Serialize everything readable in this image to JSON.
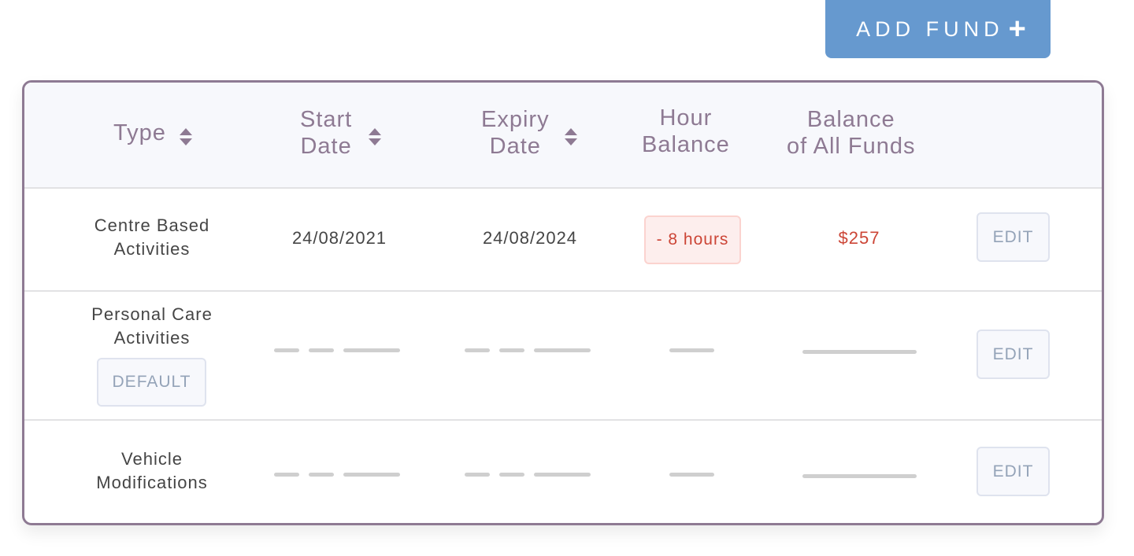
{
  "toolbar": {
    "add_fund_label": "ADD FUND",
    "add_icon": "+"
  },
  "table": {
    "headers": {
      "type": "Type",
      "start_date": [
        "Start",
        "Date"
      ],
      "expiry_date": [
        "Expiry",
        "Date"
      ],
      "hour_balance": [
        "Hour",
        "Balance"
      ],
      "balance_all_funds": [
        "Balance",
        "of All Funds"
      ]
    },
    "rows": [
      {
        "type": [
          "Centre Based",
          "Activities"
        ],
        "start_date": "24/08/2021",
        "expiry_date": "24/08/2024",
        "hour_balance": "- 8 hours",
        "balance_all_funds": "$257",
        "edit_label": "EDIT"
      },
      {
        "type": [
          "Personal Care",
          "Activities"
        ],
        "default_label": "DEFAULT",
        "start_date": null,
        "expiry_date": null,
        "hour_balance": null,
        "balance_all_funds": null,
        "edit_label": "EDIT"
      },
      {
        "type": [
          "Vehicle",
          "Modifications"
        ],
        "start_date": null,
        "expiry_date": null,
        "hour_balance": null,
        "balance_all_funds": null,
        "edit_label": "EDIT"
      }
    ]
  },
  "colors": {
    "accent": "#6699cf",
    "header_text": "#8e7a93",
    "negative": "#cc4536",
    "placeholder": "#cfcfcf"
  }
}
